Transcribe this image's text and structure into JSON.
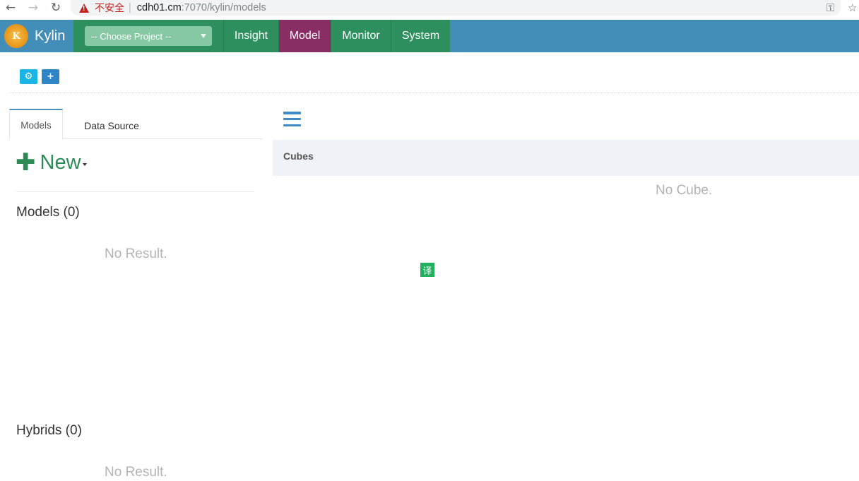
{
  "browser": {
    "security_label": "不安全",
    "url_host": "cdh01.cm",
    "url_path": ":7070/kylin/models",
    "back_glyph": "←",
    "forward_glyph": "→",
    "reload_glyph": "↻",
    "key_glyph": "⚿",
    "star_glyph": "☆"
  },
  "header": {
    "brand": "Kylin",
    "project_select": {
      "value": "-- Choose Project --"
    },
    "nav": [
      {
        "label": "Insight",
        "active": false
      },
      {
        "label": "Model",
        "active": true
      },
      {
        "label": "Monitor",
        "active": false
      },
      {
        "label": "System",
        "active": false
      }
    ],
    "colors": {
      "header": "#438eb9",
      "nav": "#2d8f5e",
      "active": "#892e65"
    }
  },
  "toolbar": {
    "buttons": [
      {
        "icon": "cogs-icon",
        "glyph": "⚙"
      },
      {
        "icon": "plus-icon",
        "glyph": "+"
      }
    ]
  },
  "left": {
    "tabs": [
      {
        "label": "Models",
        "active": true
      },
      {
        "label": "Data Source",
        "active": false
      }
    ],
    "new_label": "New",
    "models_title": "Models (0)",
    "models_empty": "No Result.",
    "hybrids_title": "Hybrids (0)",
    "hybrids_empty": "No Result."
  },
  "right": {
    "cubes_title": "Cubes",
    "cubes_empty": "No Cube."
  },
  "translate_badge": "译"
}
